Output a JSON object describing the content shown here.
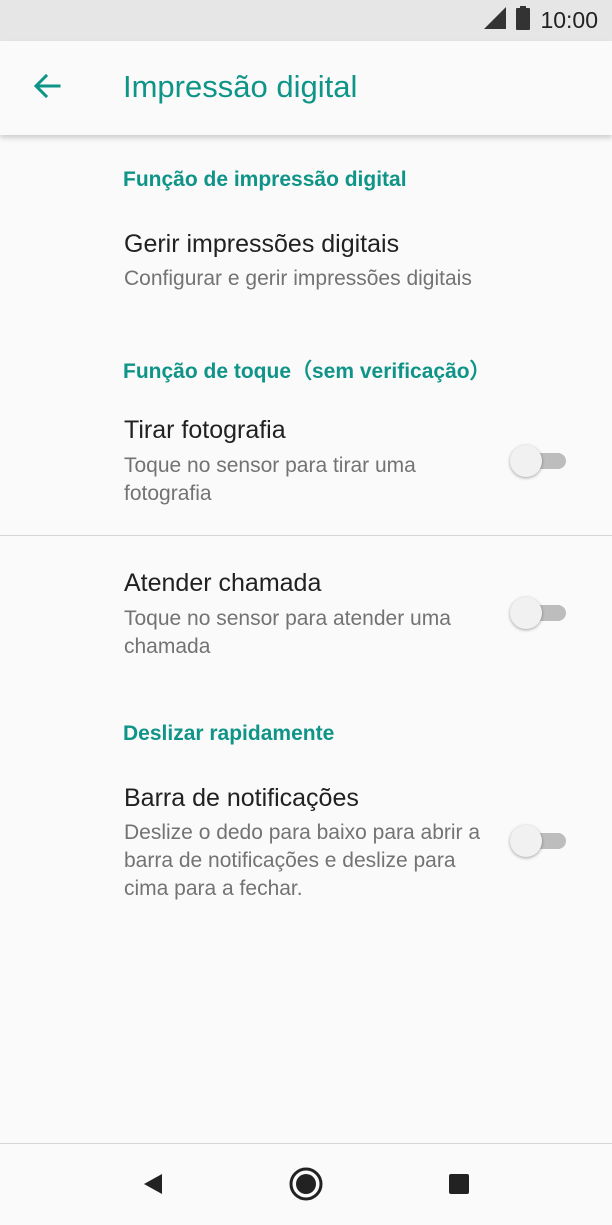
{
  "status_bar": {
    "time": "10:00",
    "icons": [
      "signal-icon",
      "battery-icon"
    ]
  },
  "app_bar": {
    "title": "Impressão digital",
    "back_icon": "arrow-back-icon"
  },
  "sections": [
    {
      "header": "Função de impressão digital",
      "items": [
        {
          "title": "Gerir impressões digitais",
          "summary": "Configurar e gerir impressões digitais"
        }
      ]
    },
    {
      "header": "Função de toque（sem verificação）",
      "items": [
        {
          "title": "Tirar fotografia",
          "summary": "Toque no sensor para tirar uma fotografia",
          "toggle": false
        },
        {
          "title": "Atender chamada",
          "summary": "Toque no sensor para atender uma chamada",
          "toggle": false
        }
      ]
    },
    {
      "header": "Deslizar rapidamente",
      "items": [
        {
          "title": "Barra de notificações",
          "summary": "Deslize o dedo para baixo para abrir a barra de notificações e deslize para cima para a fechar.",
          "toggle": false
        }
      ]
    }
  ],
  "nav_bar": {
    "icons": [
      "back-triangle-icon",
      "home-circle-icon",
      "recents-square-icon"
    ]
  },
  "colors": {
    "accent": "#0f9488",
    "status_bar": "#e6e6e6",
    "background": "#fafafa"
  }
}
